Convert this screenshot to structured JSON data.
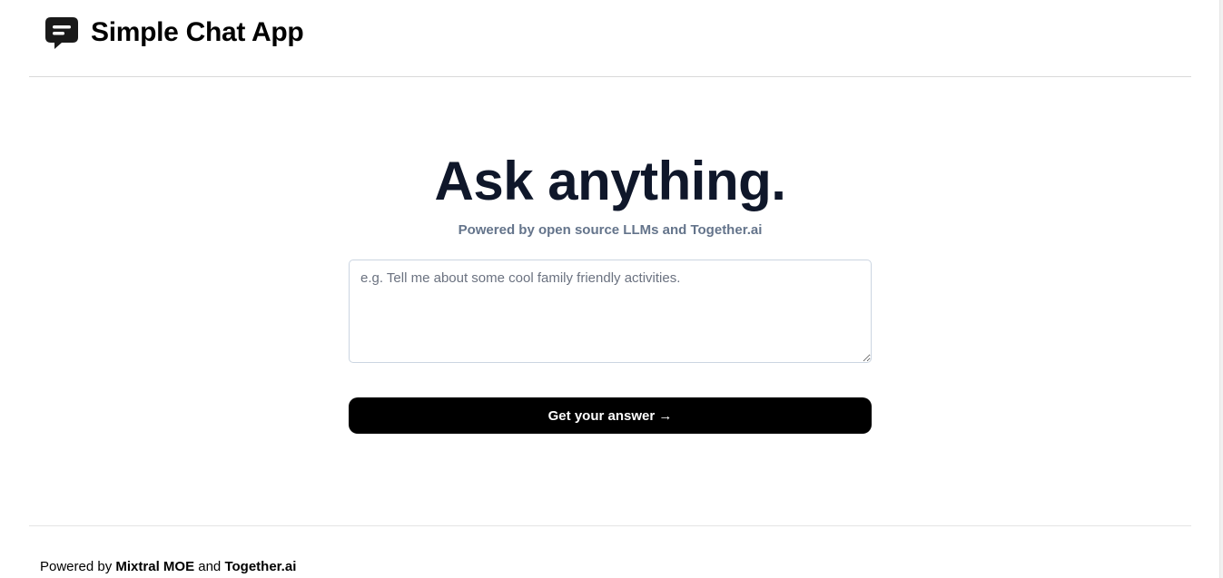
{
  "header": {
    "app_title": "Simple Chat App",
    "logo_icon": "chat-bubble-icon"
  },
  "hero": {
    "title": "Ask anything.",
    "subtitle": "Powered by open source LLMs and Together.ai"
  },
  "prompt": {
    "placeholder": "e.g. Tell me about some cool family friendly activities.",
    "value": ""
  },
  "submit": {
    "label": "Get your answer →"
  },
  "footer": {
    "prefix": "Powered by",
    "model_link": "Mixtral MOE",
    "conjunction": "and",
    "provider_link": "Together.ai"
  },
  "colors": {
    "heading": "#0f172a",
    "subtitle": "#64748b",
    "button_bg": "#000000",
    "button_text": "#ffffff"
  }
}
